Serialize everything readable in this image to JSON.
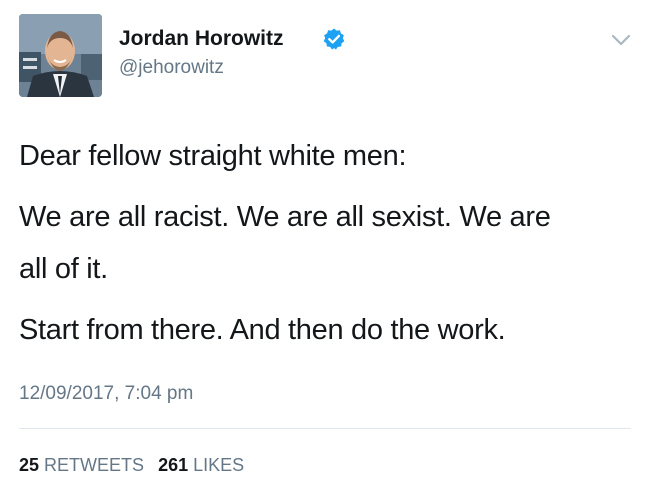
{
  "author": {
    "display_name": "Jordan Horowitz",
    "handle": "@jehorowitz",
    "verified": true
  },
  "tweet": {
    "lines": [
      "Dear fellow straight white men:",
      "We are all racist. We are all sexist. We are",
      "all of it.",
      "Start from there. And then do the work."
    ],
    "timestamp": "12/09/2017, 7:04 pm"
  },
  "stats": {
    "retweets_count": "25",
    "retweets_label": "RETWEETS",
    "likes_count": "261",
    "likes_label": "LIKES"
  },
  "colors": {
    "text": "#14171a",
    "secondary_text": "#657786",
    "verified_badge": "#1da1f2",
    "divider": "#e1e8ed"
  },
  "icons": {
    "verified": "verified-badge-icon",
    "menu": "chevron-down-icon"
  }
}
